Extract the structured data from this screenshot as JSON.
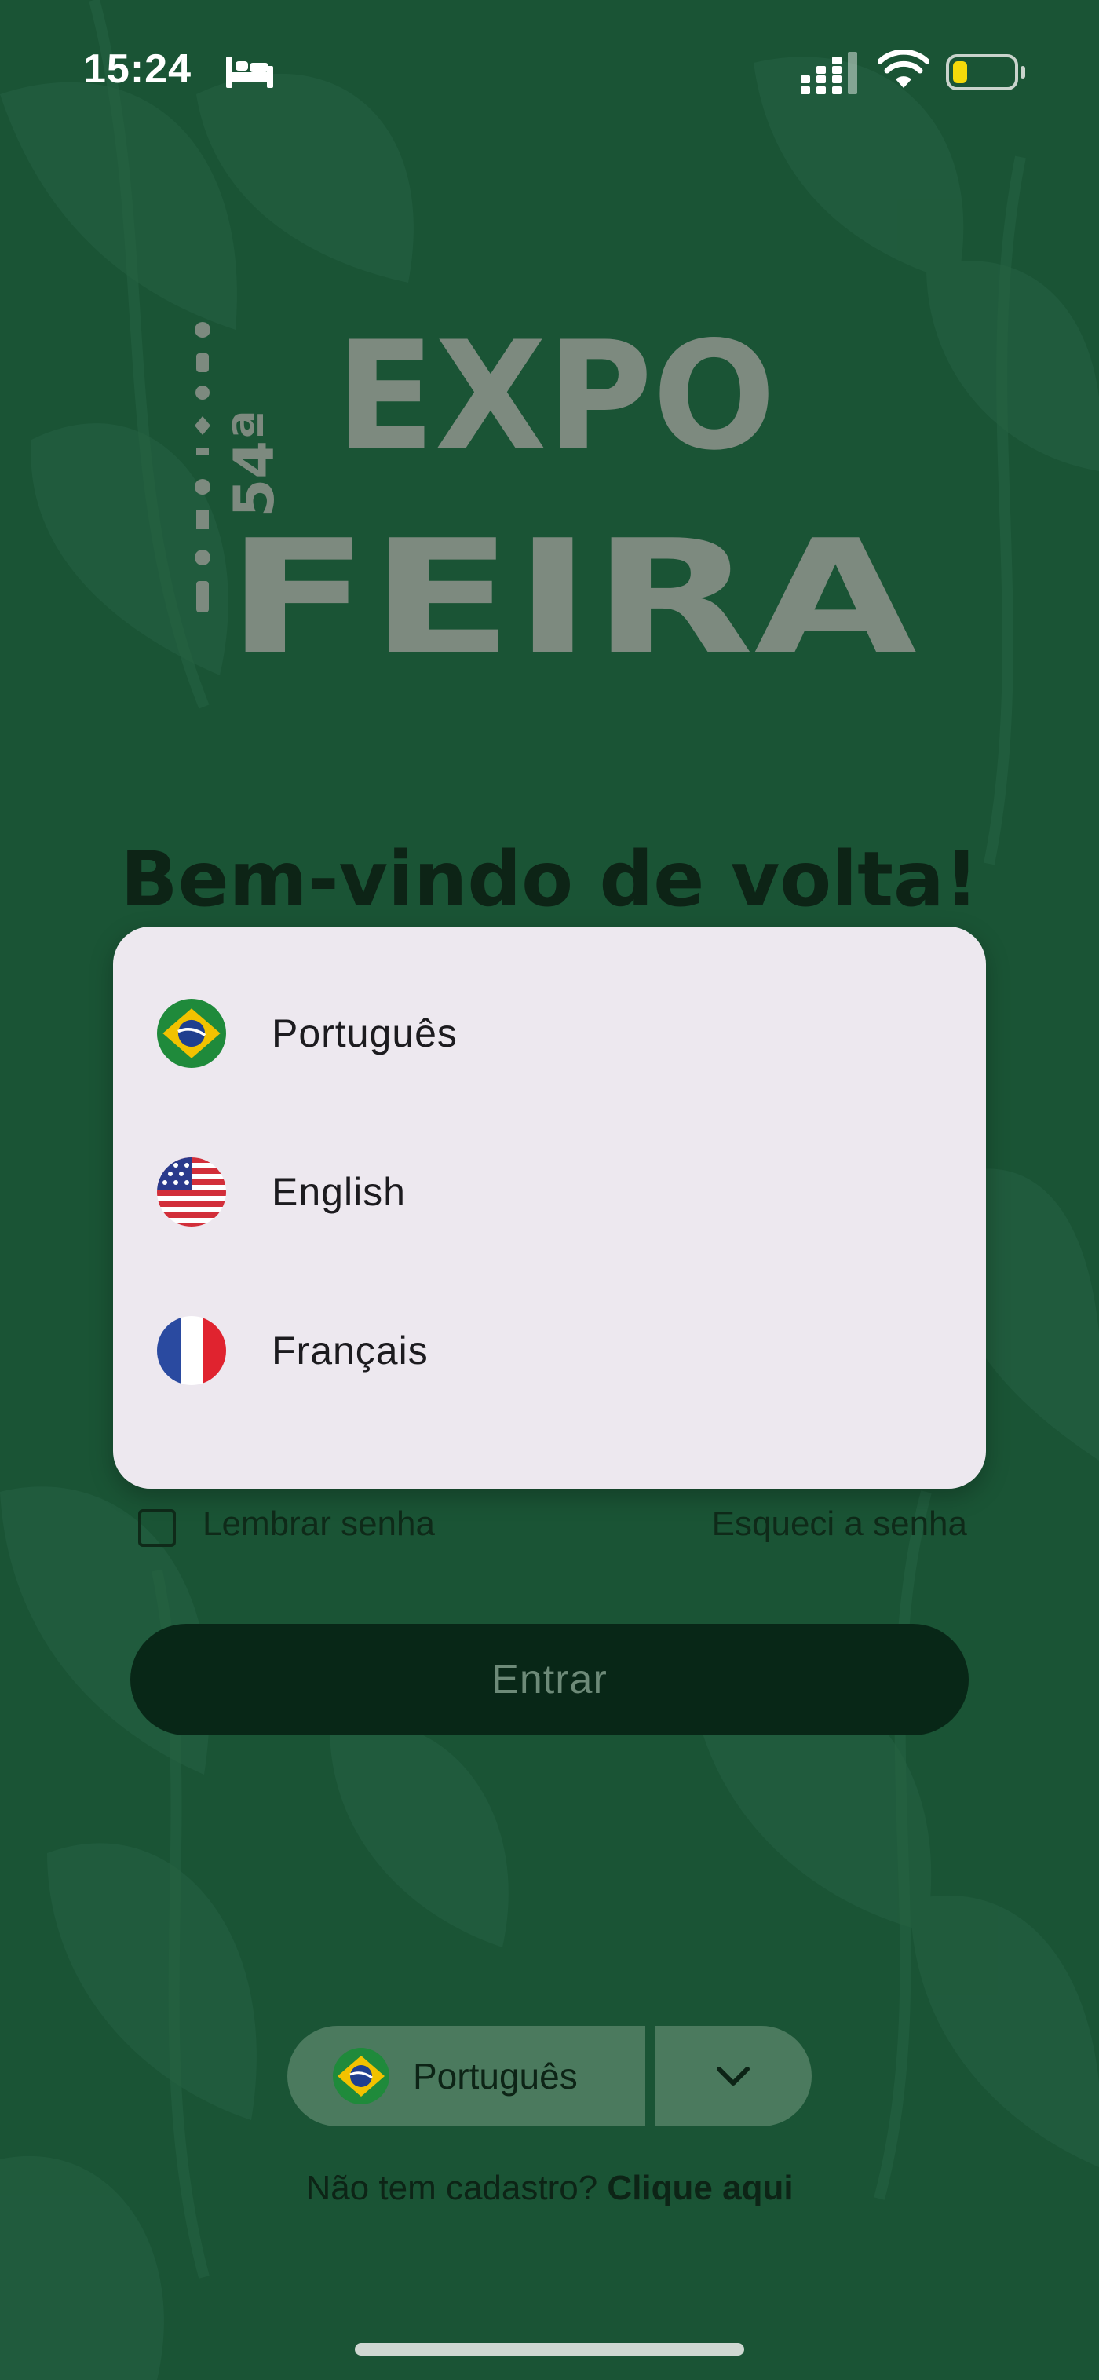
{
  "status_bar": {
    "time": "15:24",
    "icons": [
      "bed-icon",
      "cellular-signal-icon",
      "wifi-icon",
      "battery-icon"
    ]
  },
  "logo": {
    "number": "54ª",
    "line1": "EXPO",
    "line2": "FEIRA"
  },
  "welcome_title": "Bem-vindo de volta!",
  "login": {
    "remember_label": "Lembrar senha",
    "forgot_label": "Esqueci a senha",
    "enter_label": "Entrar"
  },
  "language_selector": {
    "selected": "Português",
    "selected_flag": "brazil-flag-icon",
    "dropdown_icon": "chevron-down-icon"
  },
  "signup": {
    "text": "Não tem cadastro?",
    "link": "Clique aqui"
  },
  "language_popup": {
    "options": [
      {
        "label": "Português",
        "flag": "brazil-flag-icon"
      },
      {
        "label": "English",
        "flag": "usa-flag-icon"
      },
      {
        "label": "Français",
        "flag": "france-flag-icon"
      }
    ]
  },
  "colors": {
    "background": "#1d5a3a",
    "popup": "#ede8ef",
    "button": "#082717",
    "battery_fill": "#f5d90a"
  }
}
